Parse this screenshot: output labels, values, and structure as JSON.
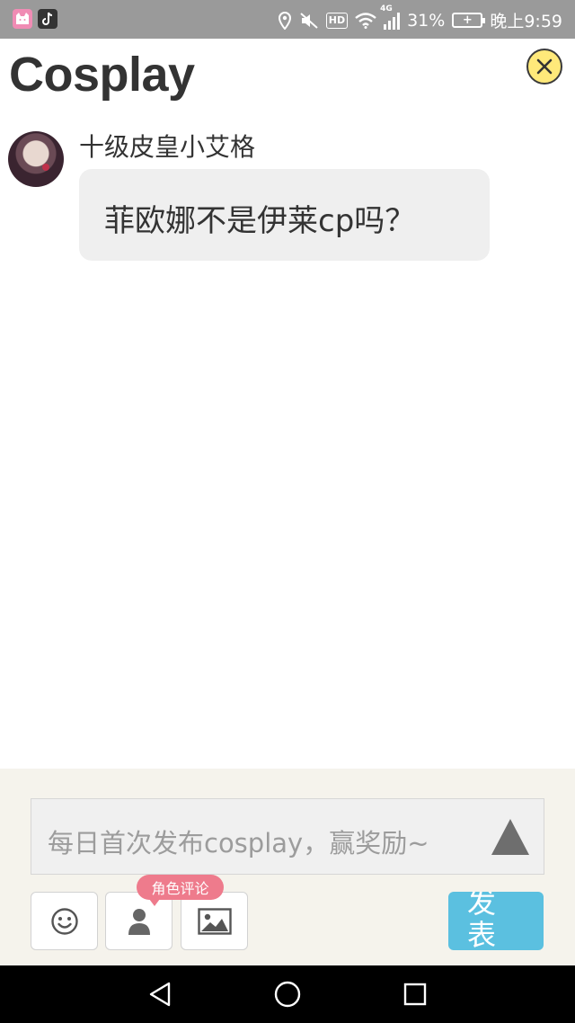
{
  "status_bar": {
    "apps": [
      "pink-cat-app-icon",
      "tiktok-icon"
    ],
    "hd_label": "HD",
    "network_label": "4G",
    "battery_percent": "31%",
    "time": "晚上9:59"
  },
  "header": {
    "title": "Cosplay",
    "close_icon": "close-x-icon"
  },
  "comment": {
    "username": "十级皮皇小艾格",
    "text": "菲欧娜不是伊莱cp吗？"
  },
  "composer": {
    "placeholder": "每日首次发布cosplay，赢奖励~",
    "role_comment_tag": "角色评论",
    "publish_label": "发表",
    "accent_color": "#5bc0e0",
    "tag_color": "#ee7b8c"
  },
  "nav_bar": {
    "buttons": [
      "back-icon",
      "home-icon",
      "recents-icon"
    ]
  }
}
